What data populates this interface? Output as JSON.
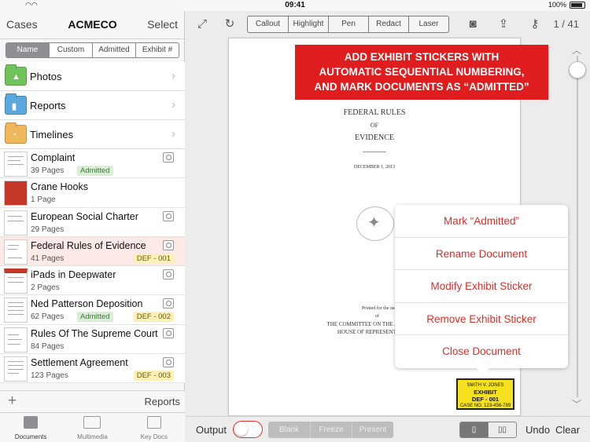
{
  "status_bar": {
    "time": "09:41",
    "battery": "100%"
  },
  "left_panel": {
    "nav": {
      "back_label": "Cases",
      "title": "ACMECO",
      "select_label": "Select"
    },
    "sort_segments": [
      "Name",
      "Custom",
      "Admitted",
      "Exhibit #"
    ],
    "folders": [
      {
        "label": "Photos",
        "color": "#6fc35a",
        "icon": "photo-icon"
      },
      {
        "label": "Reports",
        "color": "#5aa7dd",
        "icon": "document-icon"
      },
      {
        "label": "Timelines",
        "color": "#f0b75a",
        "icon": "pie-icon"
      }
    ],
    "documents": [
      {
        "name": "Complaint",
        "pages": "39 Pages",
        "admitted": "Admitted",
        "exhibit": ""
      },
      {
        "name": "Crane Hooks",
        "pages": "1 Page",
        "admitted": "",
        "exhibit": ""
      },
      {
        "name": "European Social Charter",
        "pages": "29 Pages",
        "admitted": "",
        "exhibit": ""
      },
      {
        "name": "Federal Rules of Evidence",
        "pages": "41 Pages",
        "admitted": "",
        "exhibit": "DEF - 001"
      },
      {
        "name": "iPads in Deepwater",
        "pages": "2 Pages",
        "admitted": "",
        "exhibit": ""
      },
      {
        "name": "Ned Patterson Deposition",
        "pages": "62 Pages",
        "admitted": "Admitted",
        "exhibit": "DEF - 002"
      },
      {
        "name": "Rules Of The Supreme Court",
        "pages": "84 Pages",
        "admitted": "",
        "exhibit": ""
      },
      {
        "name": "Settlement Agreement",
        "pages": "123 Pages",
        "admitted": "",
        "exhibit": "DEF - 003"
      }
    ],
    "bottom_bar": {
      "add_symbol": "+",
      "reports_label": "Reports"
    },
    "tabs": [
      {
        "label": "Documents",
        "active": true
      },
      {
        "label": "Multimedia",
        "active": false
      },
      {
        "label": "Key Docs",
        "active": false
      }
    ]
  },
  "toolbar": {
    "tools": [
      "Callout",
      "Highlight",
      "Pen",
      "Redact",
      "Laser"
    ],
    "page_indicator": "1 / 41"
  },
  "banner": {
    "line1": "ADD EXHIBIT STICKERS WITH",
    "line2": "AUTOMATIC SEQUENTIAL NUMBERING,",
    "line3": "AND MARK DOCUMENTS AS “ADMITTED”",
    "color": "#df1d1f"
  },
  "document_page": {
    "title_line1": "FEDERAL RULES",
    "title_line2": "OF",
    "title_line3": "EVIDENCE",
    "date": "DECEMBER 1, 2013",
    "footer_line1": "Printed for the use",
    "footer_line2": "of",
    "footer_line3": "THE COMMITTEE ON THE J",
    "footer_line4": "HOUSE OF REPRESENT"
  },
  "context_menu": {
    "items": [
      "Mark “Admitted”",
      "Rename Document",
      "Modify Exhibit Sticker",
      "Remove Exhibit Sticker",
      "Close Document"
    ],
    "color": "#d9302a"
  },
  "exhibit_sticker": {
    "name": "SMITH V. JONES",
    "label": "EXHIBIT",
    "number": "DEF - 001",
    "case_no": "CASE NO. 123-456-789",
    "color": "#f5e11d"
  },
  "bottom_toolbar": {
    "output_label": "Output",
    "modes": [
      "Blank",
      "Freeze",
      "Present"
    ],
    "undo_label": "Undo",
    "clear_label": "Clear"
  }
}
